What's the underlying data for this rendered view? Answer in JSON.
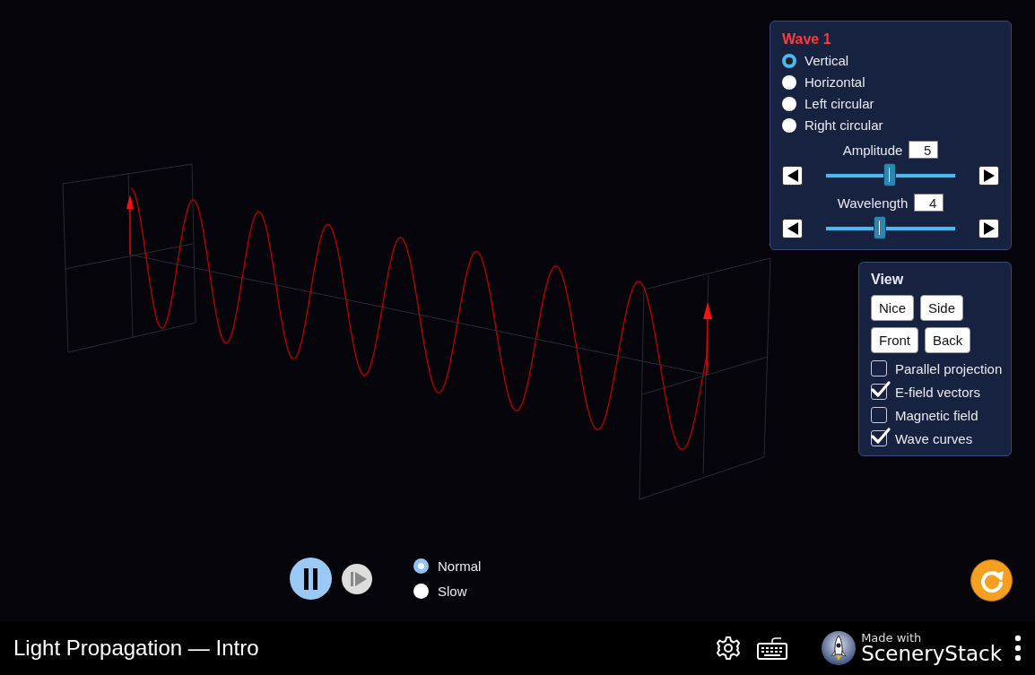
{
  "wave_panel": {
    "title": "Wave 1",
    "polarizations": [
      {
        "label": "Vertical",
        "selected": true
      },
      {
        "label": "Horizontal",
        "selected": false
      },
      {
        "label": "Left circular",
        "selected": false
      },
      {
        "label": "Right circular",
        "selected": false
      }
    ],
    "sliders": [
      {
        "label": "Amplitude",
        "value": "5",
        "level": 0.49
      },
      {
        "label": "Wavelength",
        "value": "4",
        "level": 0.42
      }
    ]
  },
  "view_panel": {
    "title": "View",
    "buttons": [
      "Nice",
      "Side",
      "Front",
      "Back"
    ],
    "options": [
      {
        "label": "Parallel projection",
        "checked": false
      },
      {
        "label": "E-field vectors",
        "checked": true
      },
      {
        "label": "Magnetic field",
        "checked": false
      },
      {
        "label": "Wave curves",
        "checked": true
      }
    ]
  },
  "playing": true,
  "speeds": [
    {
      "label": "Normal",
      "selected": true
    },
    {
      "label": "Slow",
      "selected": false
    }
  ],
  "title": "Light Propagation — Intro",
  "brand": {
    "tagline": "Made with",
    "name": "SceneryStack"
  }
}
